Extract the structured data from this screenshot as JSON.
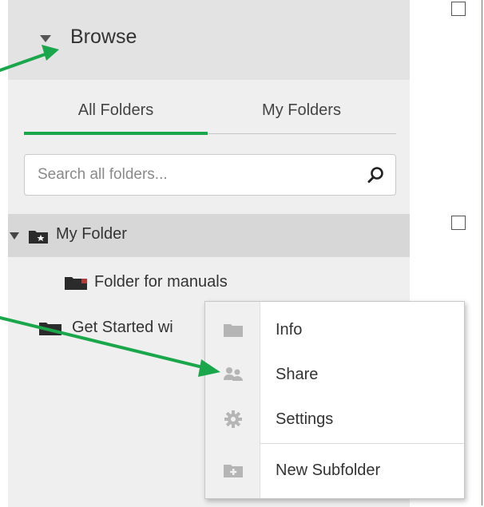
{
  "sidebar": {
    "header_title": "Browse",
    "tabs": [
      {
        "label": "All Folders",
        "active": true
      },
      {
        "label": "My Folders",
        "active": false
      }
    ],
    "search": {
      "placeholder": "Search all folders...",
      "value": ""
    },
    "tree": [
      {
        "label": "My Folder",
        "expanded": true
      },
      {
        "label": "Folder for manuals"
      },
      {
        "label": "Get Started wi"
      }
    ]
  },
  "context_menu": {
    "items": [
      {
        "label": "Info",
        "icon": "folder-icon"
      },
      {
        "label": "Share",
        "icon": "people-icon"
      },
      {
        "label": "Settings",
        "icon": "gear-icon"
      },
      {
        "label": "New Subfolder",
        "icon": "new-folder-icon"
      }
    ]
  },
  "colors": {
    "accent": "#1aa64b",
    "sidebar_bg": "#efefef",
    "header_bg": "#e3e3e3",
    "selected_row_bg": "#d7d7d7",
    "icon_gray": "#b0b0b0"
  }
}
